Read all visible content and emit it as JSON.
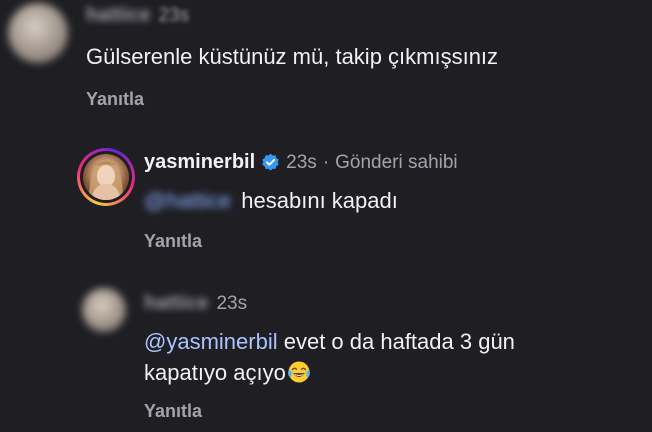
{
  "comment1": {
    "author": "hattice",
    "time": "23s",
    "text": "Gülserenle küstünüz mü, takip çıkmışsınız",
    "reply_label": "Yanıtla"
  },
  "comment2": {
    "author": "yasminerbil",
    "time": "23s",
    "separator": "·",
    "owner_label": "Gönderi sahibi",
    "mention": "@hattice",
    "text": "hesabını kapadı",
    "reply_label": "Yanıtla"
  },
  "comment3": {
    "author": "hattice",
    "time": "23s",
    "mention": "@yasminerbil",
    "text_line1": "evet o da haftada 3 gün",
    "text_line2": "kapatıyo açıyo",
    "emoji": "😂",
    "reply_label": "Yanıtla"
  },
  "colors": {
    "background": "#1e1e23",
    "mention": "#a9c4ff",
    "verified": "#3897f0",
    "story_ring_start": "#f9ce34",
    "story_ring_end": "#ee2a7b"
  },
  "icons": {
    "verified": "verified-badge-icon",
    "emoji": "face-with-tears-of-joy-icon"
  }
}
